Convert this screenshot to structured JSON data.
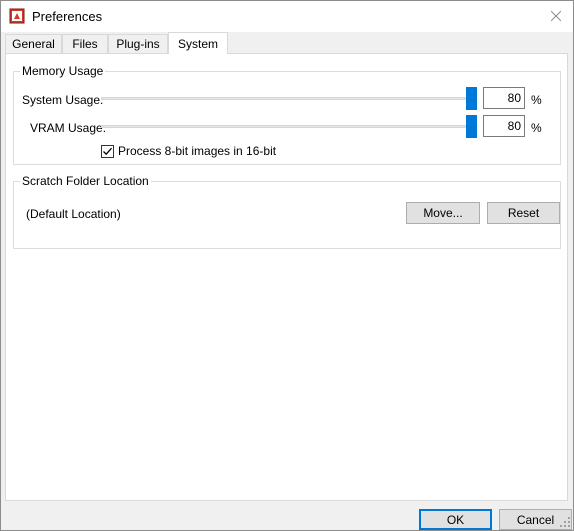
{
  "window": {
    "title": "Preferences",
    "app_icon": "preferences-app-icon",
    "close_icon": "close-icon"
  },
  "tabs": [
    {
      "label": "General",
      "active": false
    },
    {
      "label": "Files",
      "active": false
    },
    {
      "label": "Plug-ins",
      "active": false
    },
    {
      "label": "System",
      "active": true
    }
  ],
  "memory": {
    "legend": "Memory Usage",
    "system_label": "System Usage:",
    "system_value": "80",
    "system_level": 0.8,
    "vram_label": "VRAM Usage:",
    "vram_value": "80",
    "vram_level": 0.8,
    "unit": "%",
    "checkbox_label": "Process 8-bit images in 16-bit",
    "checkbox_checked": true
  },
  "scratch": {
    "legend": "Scratch Folder Location",
    "location": "(Default Location)",
    "move_label": "Move...",
    "reset_label": "Reset"
  },
  "footer": {
    "ok_label": "OK",
    "cancel_label": "Cancel"
  },
  "colors": {
    "accent": "#0078d7"
  }
}
